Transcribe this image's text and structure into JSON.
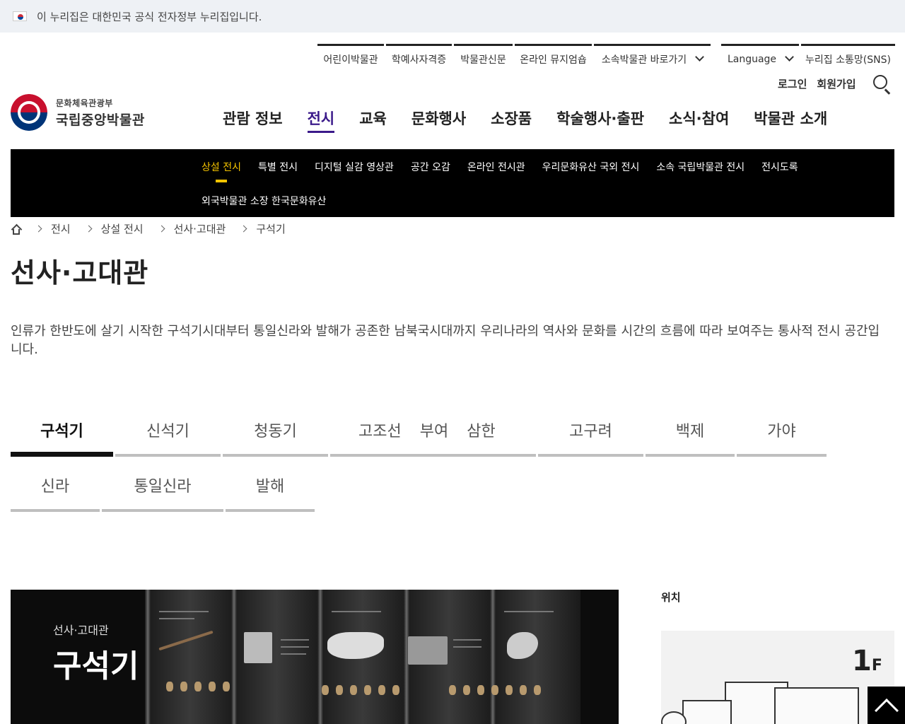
{
  "gov_banner": {
    "text": "이 누리집은 대한민국 공식 전자정부 누리집입니다."
  },
  "util_links": [
    {
      "label": "어린이박물관"
    },
    {
      "label": "학예사자격증"
    },
    {
      "label": "박물관신문"
    },
    {
      "label": "온라인 뮤지엄숍"
    },
    {
      "label": "소속박물관 바로가기"
    },
    {
      "label": "Language"
    },
    {
      "label": "누리집 소통망(SNS)"
    }
  ],
  "member": {
    "login": "로그인",
    "join": "회원가입"
  },
  "logo": {
    "ministry": "문화체육관광부",
    "name": "국립중앙박물관"
  },
  "gnb": [
    {
      "label": "관람 정보"
    },
    {
      "label": "전시"
    },
    {
      "label": "교육"
    },
    {
      "label": "문화행사"
    },
    {
      "label": "소장품"
    },
    {
      "label": "학술행사·출판"
    },
    {
      "label": "소식·참여"
    },
    {
      "label": "박물관 소개"
    }
  ],
  "subnav": {
    "row1": [
      "상설 전시",
      "특별 전시",
      "디지털 실감 영상관",
      "공간 오감",
      "온라인 전시관",
      "우리문화유산 국외 전시",
      "소속 국립박물관 전시",
      "전시도록"
    ],
    "row2": [
      "외국박물관 소장 한국문화유산"
    ]
  },
  "breadcrumb": [
    "전시",
    "상설 전시",
    "선사·고대관",
    "구석기"
  ],
  "page": {
    "title": "선사·고대관",
    "description": "인류가 한반도에 살기 시작한 구석기시대부터 통일신라와 발해가 공존한 남북국시대까지 우리나라의 역사와 문화를 시간의 흐름에 따라 보여주는 통사적 전시 공간입니다."
  },
  "tabs": [
    {
      "label": "구석기"
    },
    {
      "label": "신석기"
    },
    {
      "label": "청동기"
    },
    {
      "label": "고조선"
    },
    {
      "label": "부여"
    },
    {
      "label": "삼한"
    },
    {
      "label": "고구려"
    },
    {
      "label": "백제"
    },
    {
      "label": "가야"
    },
    {
      "label": "신라"
    },
    {
      "label": "통일신라"
    },
    {
      "label": "발해"
    }
  ],
  "exhibit": {
    "caption": "선사·고대관",
    "headline": "구석기"
  },
  "location": {
    "label": "위치",
    "floor_number": "1",
    "floor_suffix": "F"
  },
  "colors": {
    "accent": "#3b1a8a",
    "subnav_active": "#f5c400",
    "subnav_bg": "#000000"
  }
}
